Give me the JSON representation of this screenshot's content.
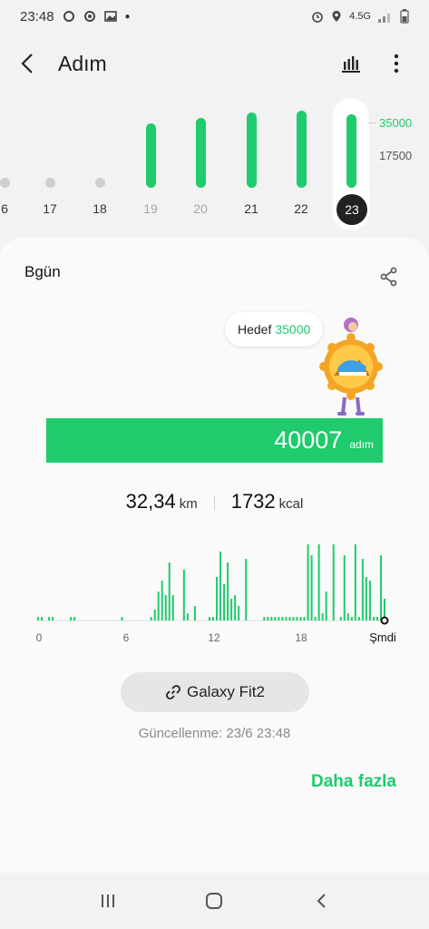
{
  "status_bar": {
    "time": "23:48",
    "network": "4.5G"
  },
  "app_bar": {
    "title": "Adım",
    "icons": [
      "back-arrow-icon",
      "bar-chart-icon",
      "more-vertical-icon"
    ]
  },
  "week_chart": {
    "goal_label": "35000",
    "mid_label": "17500",
    "days": [
      {
        "label": "6",
        "steps": 0,
        "future": false
      },
      {
        "label": "17",
        "steps": 0,
        "future": false
      },
      {
        "label": "18",
        "steps": 0,
        "future": false
      },
      {
        "label": "19",
        "steps": 35000,
        "future": true
      },
      {
        "label": "20",
        "steps": 38000,
        "future": true
      },
      {
        "label": "21",
        "steps": 41000,
        "future": false
      },
      {
        "label": "22",
        "steps": 42000,
        "future": false
      },
      {
        "label": "23",
        "steps": 40007,
        "future": false,
        "selected": true
      }
    ]
  },
  "card": {
    "title": "Bgün",
    "goal_text": "Hedef",
    "goal_value": "35000",
    "steps": "40007",
    "steps_unit": "adım",
    "distance": "32,34",
    "distance_unit": "km",
    "calories": "1732",
    "calories_unit": "kcal",
    "device_label": "Galaxy Fit2",
    "updated_text": "Güncellenme: 23/6 23:48",
    "more_label": "Daha fazla"
  },
  "chart_data": {
    "type": "bar",
    "x_ticks": [
      "0",
      "6",
      "12",
      "18",
      "Şmdi"
    ],
    "bins_per_hour": 4,
    "values": [
      1,
      1,
      0,
      1,
      1,
      0,
      0,
      0,
      0,
      1,
      1,
      0,
      0,
      0,
      0,
      0,
      0,
      0,
      0,
      0,
      0,
      0,
      0,
      1,
      0,
      0,
      0,
      0,
      0,
      0,
      0,
      1,
      3,
      8,
      11,
      7,
      16,
      7,
      0,
      0,
      14,
      2,
      0,
      4,
      0,
      0,
      0,
      1,
      1,
      12,
      19,
      10,
      16,
      6,
      7,
      4,
      0,
      17,
      0,
      0,
      0,
      0,
      1,
      1,
      1,
      1,
      1,
      1,
      1,
      1,
      1,
      1,
      1,
      1,
      21,
      18,
      1,
      21,
      2,
      8,
      0,
      21,
      0,
      1,
      18,
      2,
      1,
      21,
      1,
      17,
      12,
      11,
      1,
      1,
      18,
      6
    ],
    "max": 22
  }
}
